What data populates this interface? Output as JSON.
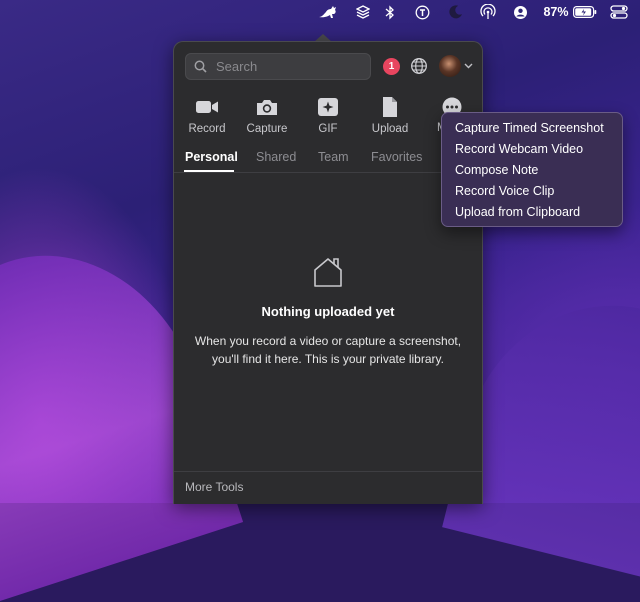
{
  "menubar": {
    "battery_percent": "87%",
    "icons": [
      "kangaroo-app-icon",
      "layers-icon",
      "bluetooth-icon",
      "info-circle-icon",
      "moon-icon",
      "airdrop-icon",
      "user-icon",
      "battery-icon",
      "control-center-icon"
    ]
  },
  "popover": {
    "search": {
      "placeholder": "Search",
      "value": ""
    },
    "notification_count": "1",
    "tools": [
      {
        "label": "Record",
        "icon": "video-camera-icon"
      },
      {
        "label": "Capture",
        "icon": "camera-icon"
      },
      {
        "label": "GIF",
        "icon": "gif-icon"
      },
      {
        "label": "Upload",
        "icon": "document-icon"
      },
      {
        "label": "M",
        "icon": "more-icon"
      }
    ],
    "tabs": [
      {
        "label": "Personal",
        "active": true
      },
      {
        "label": "Shared",
        "active": false
      },
      {
        "label": "Team",
        "active": false
      },
      {
        "label": "Favorites",
        "active": false
      }
    ],
    "empty_state": {
      "title": "Nothing uploaded yet",
      "description": "When you record a video or capture a screenshot, you'll find it here. This is your private library."
    },
    "footer": {
      "more_tools_label": "More Tools"
    }
  },
  "more_menu": {
    "items": [
      "Capture Timed Screenshot",
      "Record Webcam Video",
      "Compose Note",
      "Record Voice Clip",
      "Upload from Clipboard"
    ]
  },
  "colors": {
    "badge": "#e8455f",
    "popover_bg": "#2c2c2e",
    "menu_bg": "#3a2e54"
  }
}
